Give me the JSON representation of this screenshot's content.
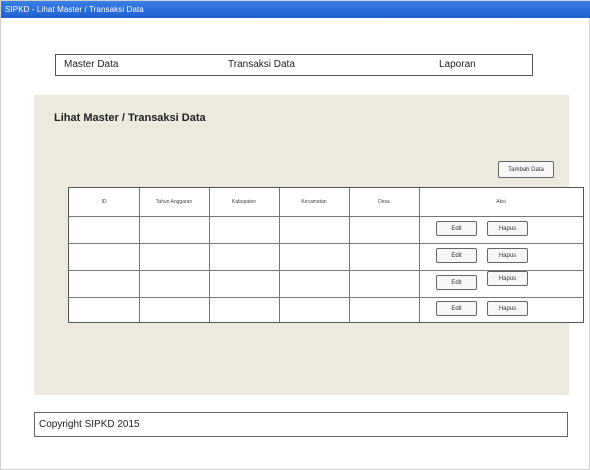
{
  "window": {
    "title": "SIPKD - Lihat Master / Transaksi Data"
  },
  "nav": {
    "items": [
      {
        "label": "Master Data"
      },
      {
        "label": "Transaksi Data"
      },
      {
        "label": "Laporan"
      }
    ]
  },
  "page": {
    "title": "Lihat Master / Transaksi Data",
    "add_button_label": "Tambah Data"
  },
  "table": {
    "columns": [
      "ID",
      "Tahun Anggaran",
      "Kabupaten",
      "Kecamatan",
      "Desa",
      "Aksi"
    ],
    "rows": [
      {
        "ID": "",
        "Tahun Anggaran": "",
        "Kabupaten": "",
        "Kecamatan": "",
        "Desa": "",
        "actions": [
          "Edit",
          "Hapus"
        ]
      },
      {
        "ID": "",
        "Tahun Anggaran": "",
        "Kabupaten": "",
        "Kecamatan": "",
        "Desa": "",
        "actions": [
          "Edit",
          "Hapus"
        ]
      },
      {
        "ID": "",
        "Tahun Anggaran": "",
        "Kabupaten": "",
        "Kecamatan": "",
        "Desa": "",
        "actions": [
          "Edit",
          "Hapus"
        ]
      },
      {
        "ID": "",
        "Tahun Anggaran": "",
        "Kabupaten": "",
        "Kecamatan": "",
        "Desa": "",
        "actions": [
          "Edit",
          "Hapus"
        ]
      }
    ]
  },
  "footer": {
    "text": "Copyright SIPKD 2015"
  },
  "colors": {
    "titlebar": "#2a6fe0",
    "panel": "#ece9df"
  }
}
